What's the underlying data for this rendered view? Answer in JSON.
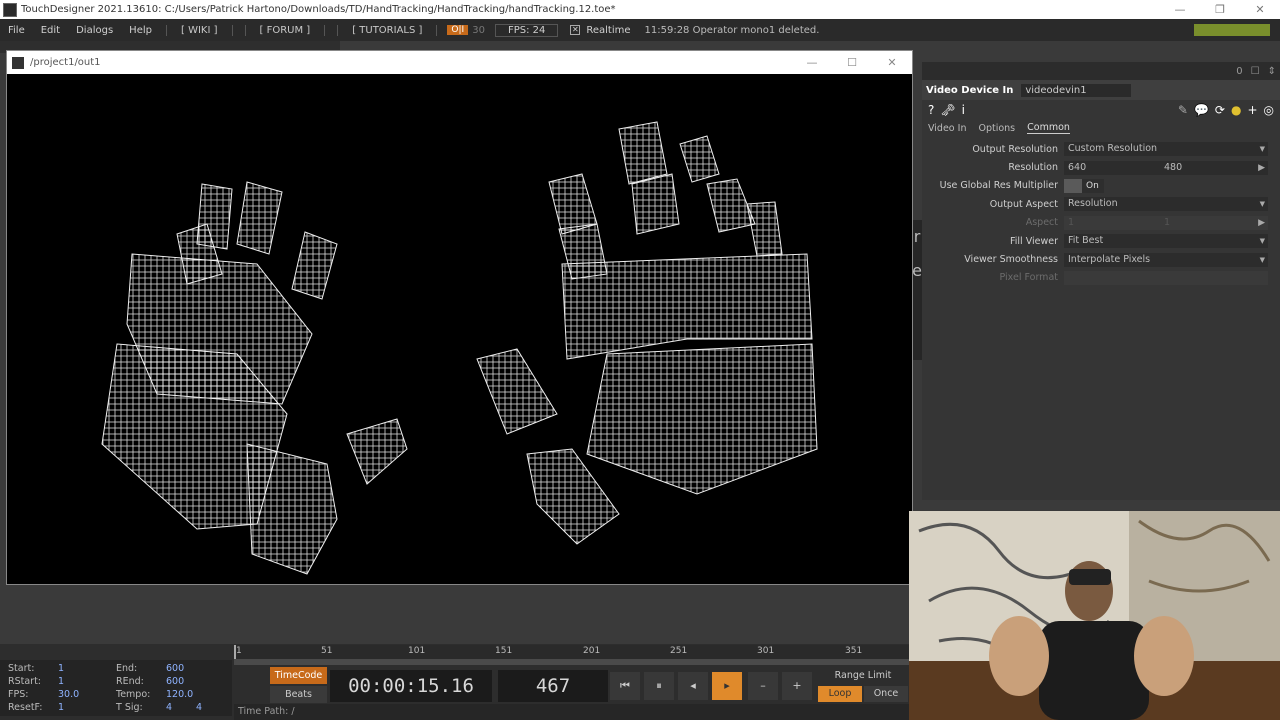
{
  "window": {
    "title": "TouchDesigner 2021.13610: C:/Users/Patrick Hartono/Downloads/TD/HandTracking/HandTracking/handTracking.12.toe*",
    "min": "—",
    "max": "❐",
    "close": "✕"
  },
  "menu": {
    "items": [
      "File",
      "Edit",
      "Dialogs",
      "Help"
    ],
    "wiki": "[ WIKI ]",
    "forum": "[ FORUM ]",
    "tutorials": "[ TUTORIALS ]",
    "oi": "O|I",
    "thirty": "30",
    "fps": "FPS:  24",
    "realtime_check": "✕",
    "realtime": "Realtime",
    "status": "11:59:28 Operator mono1 deleted."
  },
  "viewer": {
    "title": "/project1/out1",
    "min": "—",
    "max": "☐",
    "close": "✕"
  },
  "params": {
    "top_count": "0",
    "op_type": "Video Device In",
    "op_name": "videodevin1",
    "help_icon": "?",
    "info_icon": "i",
    "tabs": [
      "Video In",
      "Options",
      "Common"
    ],
    "rows": {
      "output_resolution": {
        "label": "Output Resolution",
        "value": "Custom Resolution"
      },
      "resolution": {
        "label": "Resolution",
        "w": "640",
        "h": "480"
      },
      "global_res": {
        "label": "Use Global Res Multiplier",
        "value": "On"
      },
      "output_aspect": {
        "label": "Output Aspect",
        "value": "Resolution"
      },
      "aspect": {
        "label": "Aspect",
        "a": "1",
        "b": "1"
      },
      "fill_viewer": {
        "label": "Fill Viewer",
        "value": "Fit Best"
      },
      "viewer_smoothness": {
        "label": "Viewer Smoothness",
        "value": "Interpolate Pixels"
      },
      "pixel_format": {
        "label": "Pixel Format",
        "value": ""
      }
    }
  },
  "timeline": {
    "ruler": [
      "1",
      "51",
      "101",
      "151",
      "201",
      "251",
      "301",
      "351"
    ],
    "stats": {
      "start_l": "Start:",
      "start_v": "1",
      "rstart_l": "RStart:",
      "rstart_v": "1",
      "fps_l": "FPS:",
      "fps_v": "30.0",
      "resetf_l": "ResetF:",
      "resetf_v": "1",
      "end_l": "End:",
      "end_v": "600",
      "rend_l": "REnd:",
      "rend_v": "600",
      "tempo_l": "Tempo:",
      "tempo_v": "120.0",
      "tsig_l": "T Sig:",
      "tsig_a": "4",
      "tsig_b": "4"
    },
    "timecode_btn": "TimeCode",
    "beats_btn": "Beats",
    "timecode": "00:00:15.16",
    "frame": "467",
    "controls": {
      "rewind": "⏮",
      "pause": "⏸",
      "step_back": "◂",
      "play": "▸",
      "minus": "–",
      "plus": "+"
    },
    "range_label": "Range Limit",
    "loop": "Loop",
    "once": "Once",
    "time_path": "Time Path: /"
  }
}
